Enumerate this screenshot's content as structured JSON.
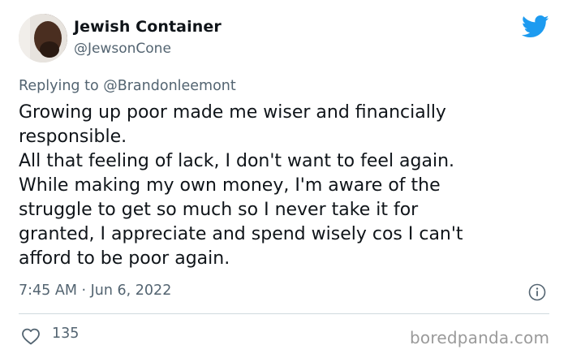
{
  "tweet": {
    "author_name": "Jewish Container",
    "author_handle": "@JewsonCone",
    "replying_prefix": "Replying to ",
    "replying_to": "@Brandonleemont",
    "body_lines": [
      "Growing up poor made me wiser and financially",
      "responsible.",
      "All that feeling of lack, I don't want to feel again.",
      "While making my own money, I'm aware of the",
      "struggle to get so much so I never take it for",
      "granted, I appreciate and spend wisely cos I can't",
      "afford to be poor again."
    ],
    "timestamp": "7:45 AM · Jun 6, 2022",
    "likes": "135"
  },
  "icons": {
    "brand": "twitter-bird-icon",
    "info": "info-icon",
    "like": "heart-icon"
  },
  "watermark": "boredpanda.com",
  "colors": {
    "brand_blue": "#1d9bf0",
    "text": "#0f1419",
    "secondary": "#536471",
    "divider": "#cfd9de"
  }
}
